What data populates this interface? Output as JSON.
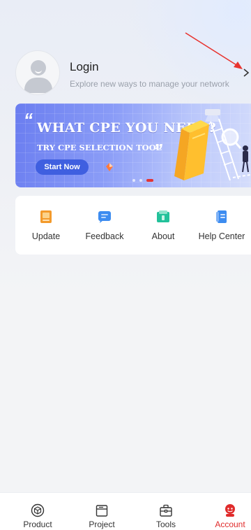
{
  "profile": {
    "title": "Login",
    "subtitle": "Explore new ways to manage your network",
    "chevron": ">"
  },
  "banner": {
    "quote_open": "“",
    "quote_close": "”",
    "title": "WHAT CPE YOU NEED?",
    "subtitle": "TRY CPE SELECTION TOOL",
    "button_label": "Start Now",
    "slides_count": 3,
    "active_slide": 3
  },
  "quick_menu": {
    "items": [
      {
        "label": "Update",
        "icon": "update-icon",
        "color": "#f39a2b"
      },
      {
        "label": "Feedback",
        "icon": "feedback-icon",
        "color": "#3d8cf0"
      },
      {
        "label": "About",
        "icon": "about-icon",
        "color": "#22c19a"
      },
      {
        "label": "Help Center",
        "icon": "help-center-icon",
        "color": "#3d8cf0"
      }
    ]
  },
  "bottom_nav": {
    "items": [
      {
        "label": "Product",
        "icon": "cube-icon",
        "active": false
      },
      {
        "label": "Project",
        "icon": "folder-icon",
        "active": false
      },
      {
        "label": "Tools",
        "icon": "toolbox-icon",
        "active": false
      },
      {
        "label": "Account",
        "icon": "account-icon",
        "active": true
      }
    ]
  },
  "colors": {
    "accent": "#e02b2b",
    "banner_button": "#3f5fe0",
    "annotation_arrow": "#e8332f"
  }
}
